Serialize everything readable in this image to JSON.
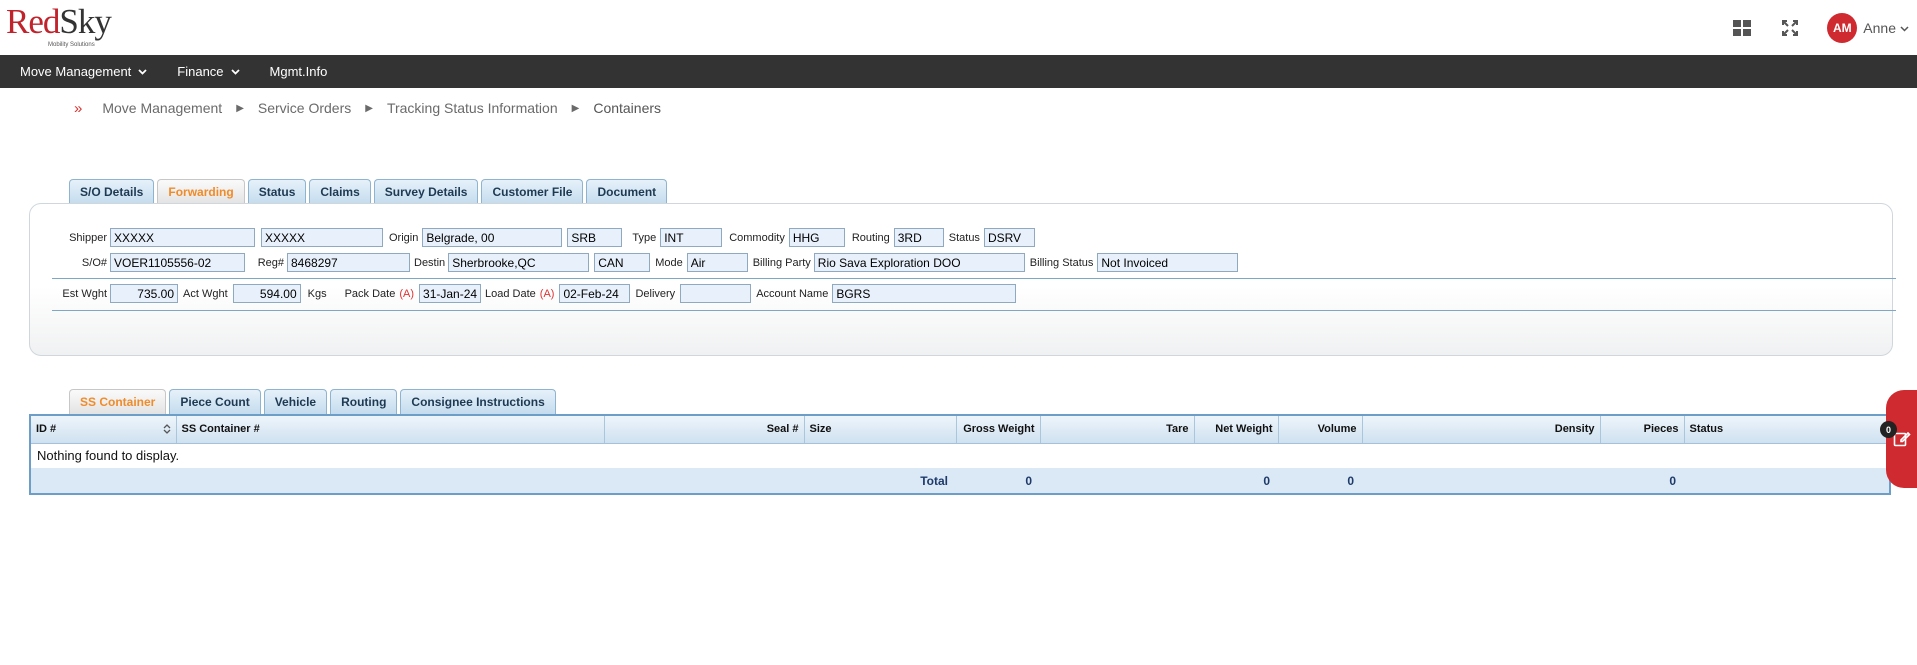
{
  "brand": {
    "name_red": "Red",
    "name_dark": "Sky",
    "tagline": "Mobility Solutions"
  },
  "user": {
    "initials": "AM",
    "name": "Anne"
  },
  "colors": {
    "accent": "#cf2a2f",
    "navbar": "#333333",
    "active_tab_text": "#f08b2a",
    "field_bg": "#e8f1fb"
  },
  "icons": {
    "apps": "grid-icon",
    "expand": "expand-icon",
    "user_menu": "chevron-down-icon",
    "edit": "edit-icon"
  },
  "nav": [
    {
      "label": "Move Management",
      "has_menu": true
    },
    {
      "label": "Finance",
      "has_menu": true
    },
    {
      "label": "Mgmt.Info",
      "has_menu": false
    }
  ],
  "breadcrumb": [
    "Move Management",
    "Service Orders",
    "Tracking Status Information",
    "Containers"
  ],
  "top_tabs": [
    "S/O Details",
    "Forwarding",
    "Status",
    "Claims",
    "Survey Details",
    "Customer File",
    "Document"
  ],
  "top_tab_active": "Forwarding",
  "form": {
    "shipper_label": "Shipper",
    "shipper_first": "XXXXX",
    "shipper_last": "XXXXX",
    "origin_label": "Origin",
    "origin_city": "Belgrade, 00",
    "origin_country": "SRB",
    "type_label": "Type",
    "type_value": "INT",
    "commodity_label": "Commodity",
    "commodity_value": "HHG",
    "routing_label": "Routing",
    "routing_value": "3RD",
    "status_label": "Status",
    "status_value": "DSRV",
    "so_label": "S/O#",
    "so_value": "VOER1105556-02",
    "reg_label": "Reg#",
    "reg_value": "8468297",
    "destin_label": "Destin",
    "destin_city": "Sherbrooke,QC",
    "destin_country": "CAN",
    "mode_label": "Mode",
    "mode_value": "Air",
    "billing_party_label": "Billing Party",
    "billing_party_value": "Rio Sava Exploration DOO",
    "billing_status_label": "Billing Status",
    "billing_status_value": "Not Invoiced",
    "est_wght_label": "Est Wght",
    "est_wght_value": "735.00",
    "act_wght_label": "Act Wght",
    "act_wght_value": "594.00",
    "wght_unit": "Kgs",
    "pack_date_label": "Pack Date",
    "actual_marker": "(A)",
    "pack_date_value": "31-Jan-24",
    "load_date_label": "Load Date",
    "load_date_value": "02-Feb-24",
    "delivery_label": "Delivery",
    "delivery_value": "",
    "account_name_label": "Account Name",
    "account_name_value": "BGRS"
  },
  "sub_tabs": [
    "SS Container",
    "Piece Count",
    "Vehicle",
    "Routing",
    "Consignee Instructions"
  ],
  "sub_tab_active": "SS Container",
  "table": {
    "columns": [
      "ID #",
      "SS Container #",
      "Seal #",
      "Size",
      "Gross Weight",
      "Tare",
      "Net Weight",
      "Volume",
      "Density",
      "Pieces",
      "Status"
    ],
    "empty_message": "Nothing found to display.",
    "total_label": "Total",
    "totals": {
      "gross_weight": "0",
      "net_weight": "0",
      "volume": "0",
      "pieces": "0"
    }
  },
  "side_badge": "0"
}
